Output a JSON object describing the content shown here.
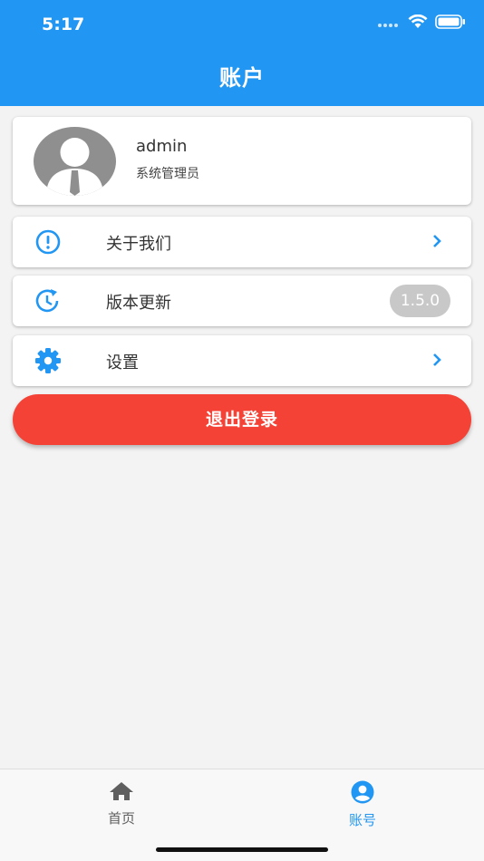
{
  "status_bar": {
    "time": "5:17"
  },
  "header": {
    "title": "账户"
  },
  "profile": {
    "username": "admin",
    "role": "系统管理员"
  },
  "menu": {
    "items": [
      {
        "label": "关于我们",
        "icon": "info-icon"
      },
      {
        "label": "版本更新",
        "icon": "update-icon",
        "badge": "1.5.0"
      },
      {
        "label": "设置",
        "icon": "gear-icon"
      }
    ]
  },
  "logout": {
    "label": "退出登录"
  },
  "tabbar": {
    "tabs": [
      {
        "label": "首页",
        "icon": "home-icon"
      },
      {
        "label": "账号",
        "icon": "account-circle-icon",
        "active": true
      }
    ]
  },
  "colors": {
    "primary": "#2196f3",
    "danger": "#f44336",
    "badge": "#c8c8c8"
  }
}
